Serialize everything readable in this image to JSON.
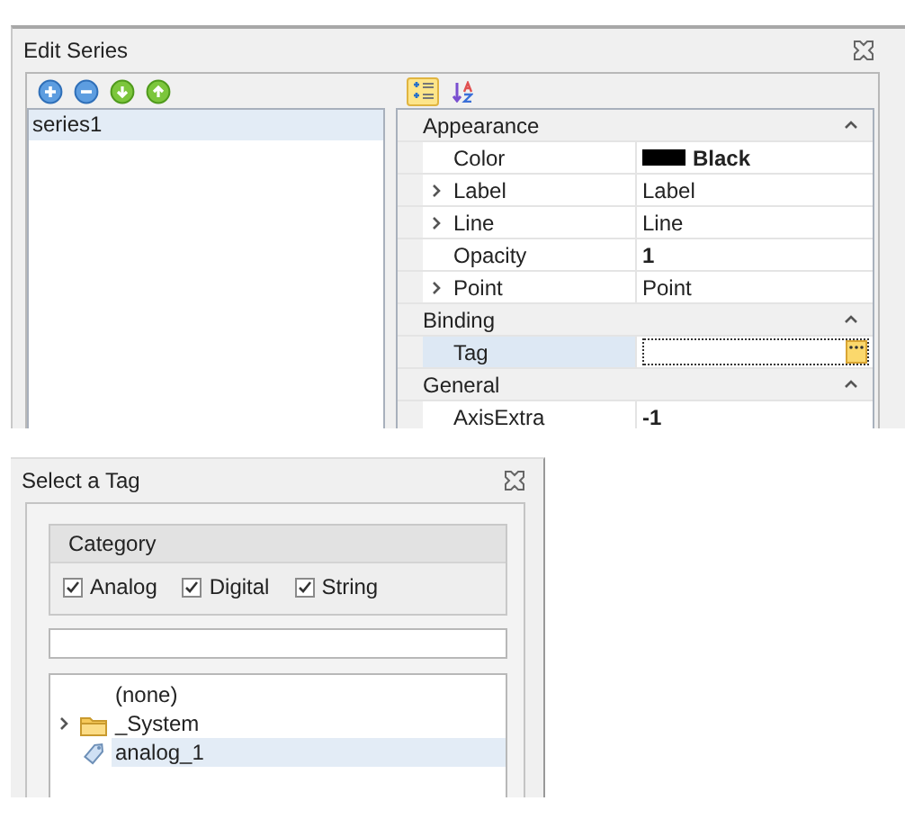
{
  "edit_series": {
    "title": "Edit Series",
    "toolbar": [
      {
        "kind": "add"
      },
      {
        "kind": "remove"
      },
      {
        "kind": "down"
      },
      {
        "kind": "up"
      }
    ],
    "sort_buttons": [
      {
        "kind": "categorized",
        "selected": true
      },
      {
        "kind": "alphabetical",
        "selected": false
      }
    ],
    "series": [
      {
        "name": "series1",
        "selected": true
      }
    ],
    "categories": [
      {
        "name": "Appearance",
        "expanded": true,
        "properties": [
          {
            "name": "Color",
            "value": "Black",
            "kind": "color",
            "color": "#000000",
            "expandable": false,
            "modified": true,
            "selected": false
          },
          {
            "name": "Label",
            "value": "Label",
            "kind": "text",
            "expandable": true,
            "modified": false,
            "selected": false
          },
          {
            "name": "Line",
            "value": "Line",
            "kind": "text",
            "expandable": true,
            "modified": false,
            "selected": false
          },
          {
            "name": "Opacity",
            "value": "1",
            "kind": "text",
            "expandable": false,
            "modified": true,
            "selected": false
          },
          {
            "name": "Point",
            "value": "Point",
            "kind": "text",
            "expandable": true,
            "modified": false,
            "selected": false
          }
        ]
      },
      {
        "name": "Binding",
        "expanded": true,
        "properties": [
          {
            "name": "Tag",
            "kind": "picker",
            "expandable": false,
            "selected": true
          }
        ]
      },
      {
        "name": "General",
        "expanded": true,
        "properties": [
          {
            "name": "AxisExtra",
            "value": "-1",
            "kind": "text",
            "expandable": false,
            "modified": true,
            "selected": false
          }
        ]
      }
    ]
  },
  "select_tag": {
    "title": "Select a Tag",
    "category": {
      "label": "Category",
      "options": [
        {
          "label": "Analog",
          "checked": true
        },
        {
          "label": "Digital",
          "checked": true
        },
        {
          "label": "String",
          "checked": true
        }
      ]
    },
    "tree": [
      {
        "label": "(none)",
        "kind": "none",
        "selected": false
      },
      {
        "label": "_System",
        "kind": "folder",
        "expanded": false,
        "selected": false
      },
      {
        "label": "analog_1",
        "kind": "tag",
        "selected": true
      }
    ]
  }
}
